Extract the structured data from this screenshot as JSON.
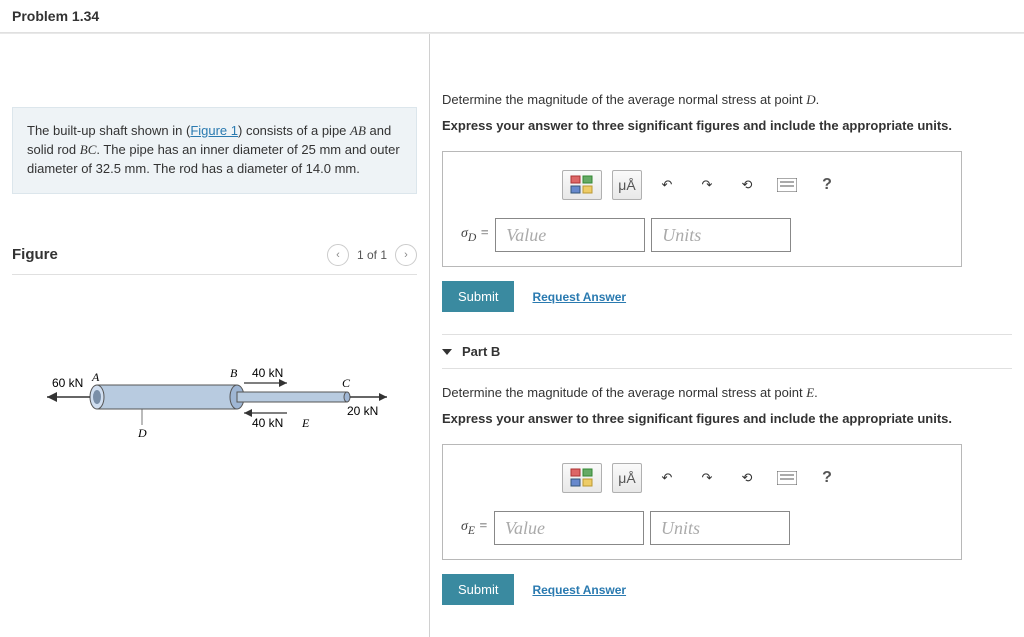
{
  "header": {
    "title": "Problem 1.34"
  },
  "problem": {
    "pre": "The built-up shaft shown in (",
    "figLink": "Figure 1",
    "post1": ") consists of a pipe ",
    "varAB": "AB",
    "post2": " and solid rod ",
    "varBC": "BC",
    "post3": ". The pipe has an inner diameter of 25 mm and outer diameter of 32.5 mm. The rod has a diameter of 14.0 mm."
  },
  "figure": {
    "title": "Figure",
    "pager": "1 of 1",
    "labels": {
      "f60": "60 kN",
      "f40t": "40 kN",
      "f40b": "40 kN",
      "f20": "20 kN",
      "A": "A",
      "B": "B",
      "C": "C",
      "D": "D",
      "E": "E"
    }
  },
  "partD": {
    "prompt_pre": "Determine the magnitude of the average normal stress at point ",
    "point": "D",
    "instr": "Express your answer to three significant figures and include the appropriate units.",
    "sigma_pre": "σ",
    "sigma_sub": "D",
    "equals": " = ",
    "value_ph": "Value",
    "units_ph": "Units",
    "submit": "Submit",
    "request": "Request Answer",
    "mu": "μÅ",
    "qmark": "?"
  },
  "partB": {
    "header": "Part B",
    "prompt_pre": "Determine the magnitude of the average normal stress at point ",
    "point": "E",
    "instr": "Express your answer to three significant figures and include the appropriate units.",
    "sigma_pre": "σ",
    "sigma_sub": "E",
    "equals": " = ",
    "value_ph": "Value",
    "units_ph": "Units",
    "submit": "Submit",
    "request": "Request Answer",
    "mu": "μÅ",
    "qmark": "?"
  }
}
